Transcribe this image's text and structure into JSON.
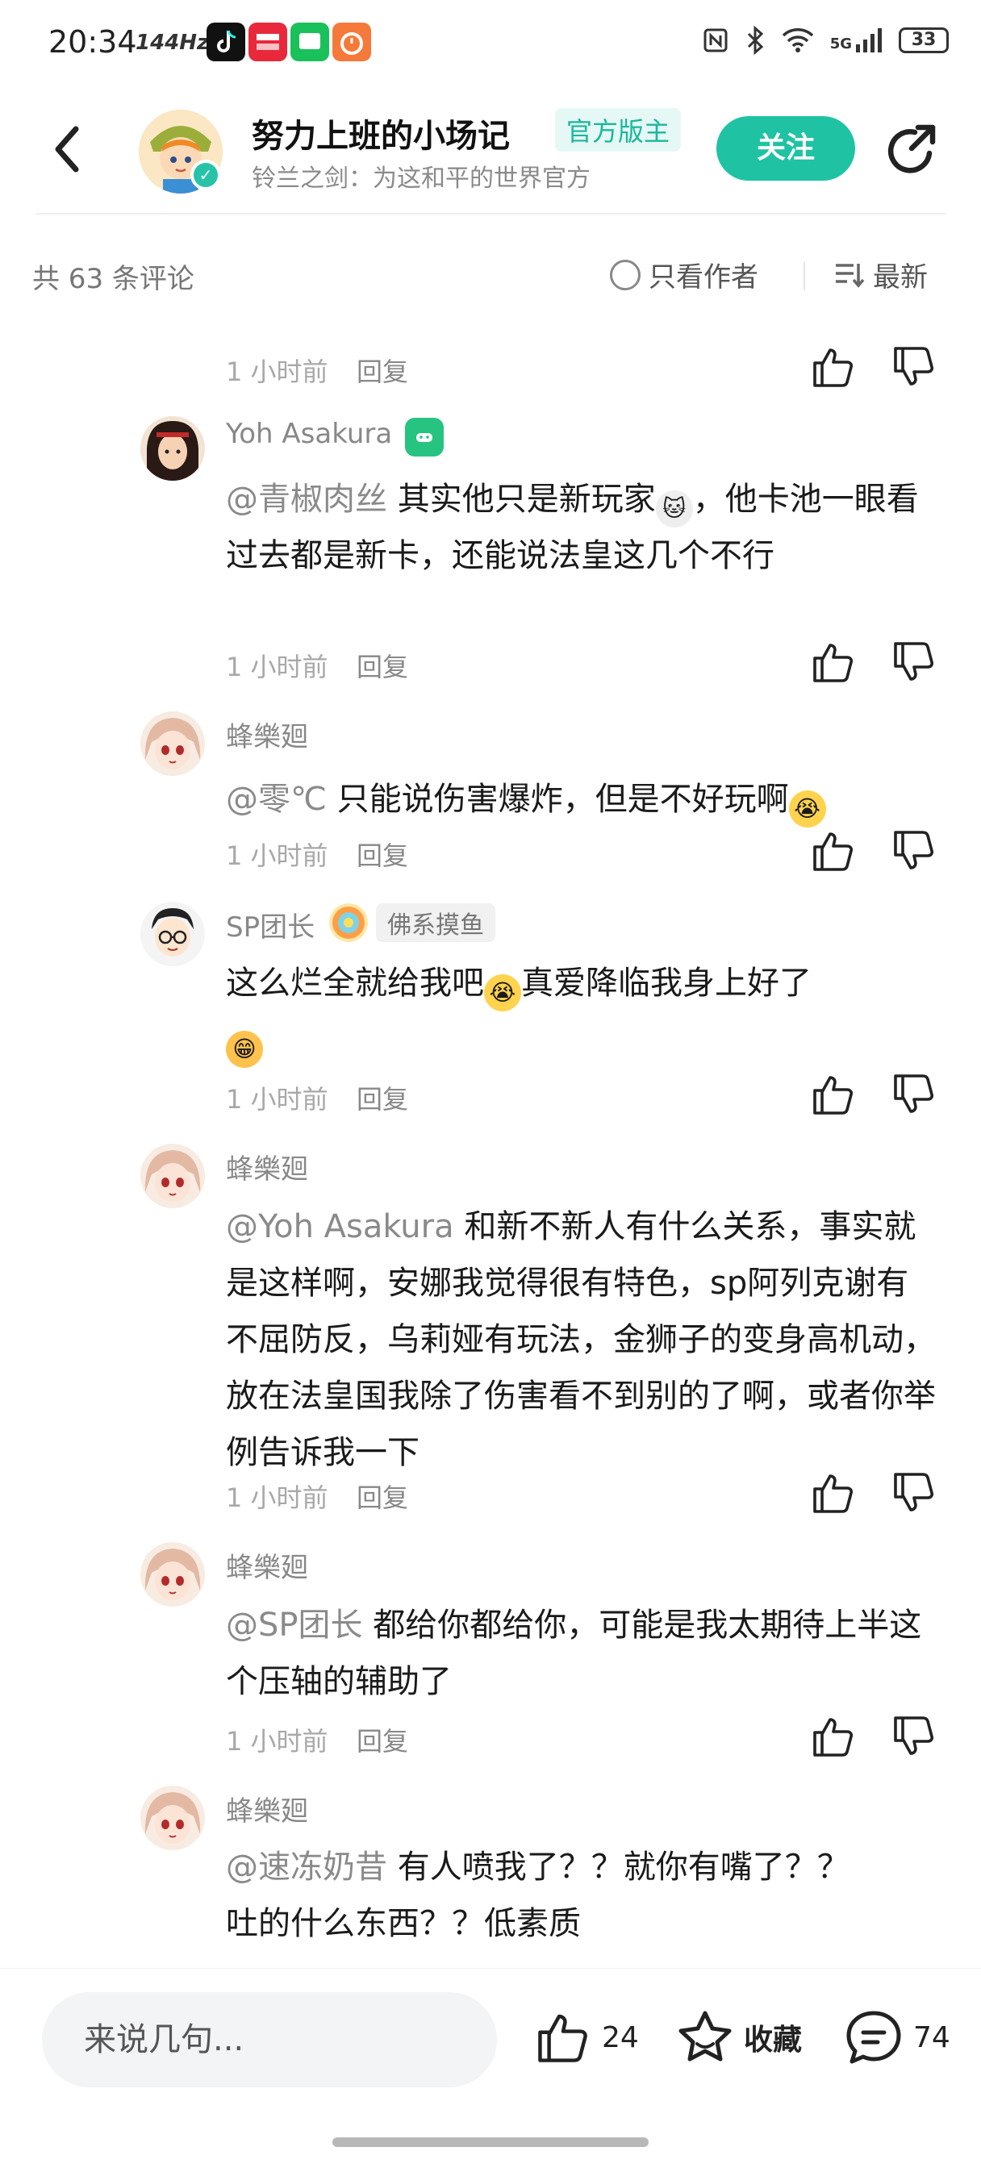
{
  "status_bar": {
    "time": "20:34",
    "refresh": "144Hz",
    "network": "5G",
    "battery": "33",
    "app_icons": [
      {
        "name": "tiktok-icon",
        "color": "#111111"
      },
      {
        "name": "xiaohongshu-icon",
        "color": "#e8293c"
      },
      {
        "name": "chat-app-icon",
        "color": "#19c15a"
      },
      {
        "name": "timer-app-icon",
        "color": "#f57a3a"
      }
    ]
  },
  "header": {
    "title": "努力上班的小场记",
    "official_badge": "官方版主",
    "subtitle": "铃兰之剑：为这和平的世界官方",
    "follow_label": "关注",
    "accent_color": "#1fc3a3"
  },
  "toolbar": {
    "comment_count": "共 63 条评论",
    "only_author": "只看作者",
    "sort_label": "最新"
  },
  "comments": [
    {
      "time": "1 小时前",
      "reply": "回复"
    },
    {
      "author": "Yoh Asakura",
      "mention": "@青椒肉丝",
      "text_a": " 其实他只是新玩家",
      "text_b": "，他卡池一眼看过去都是新卡，还能说法皇这几个不行",
      "time": "1 小时前",
      "reply": "回复"
    },
    {
      "author": "蜂樂廻",
      "mention": "@零℃",
      "text_a": " 只能说伤害爆炸，但是不好玩啊",
      "time": "1 小时前",
      "reply": "回复"
    },
    {
      "author": "SP团长",
      "tag": "佛系摸鱼",
      "text_a": "这么烂全就给我吧",
      "text_b": "真爱降临我身上好了",
      "time": "1 小时前",
      "reply": "回复"
    },
    {
      "author": "蜂樂廻",
      "mention": "@Yoh Asakura",
      "text_a": " 和新不新人有什么关系，事实就是这样啊，安娜我觉得很有特色，sp阿列克谢有不屈防反，乌莉娅有玩法，金狮子的变身高机动，放在法皇国我除了伤害看不到别的了啊，或者你举例告诉我一下",
      "time": "1 小时前",
      "reply": "回复"
    },
    {
      "author": "蜂樂廻",
      "mention": "@SP团长",
      "text_a": " 都给你都给你，可能是我太期待上半这个压轴的辅助了",
      "time": "1 小时前",
      "reply": "回复"
    },
    {
      "author": "蜂樂廻",
      "mention": "@速冻奶昔",
      "text_a": " 有人喷我了？？就你有嘴了？？吐的什么东西？？低素质"
    }
  ],
  "bottom_bar": {
    "input_placeholder": "来说几句...",
    "like_count": "24",
    "favorite_label": "收藏",
    "comment_count": "74"
  }
}
